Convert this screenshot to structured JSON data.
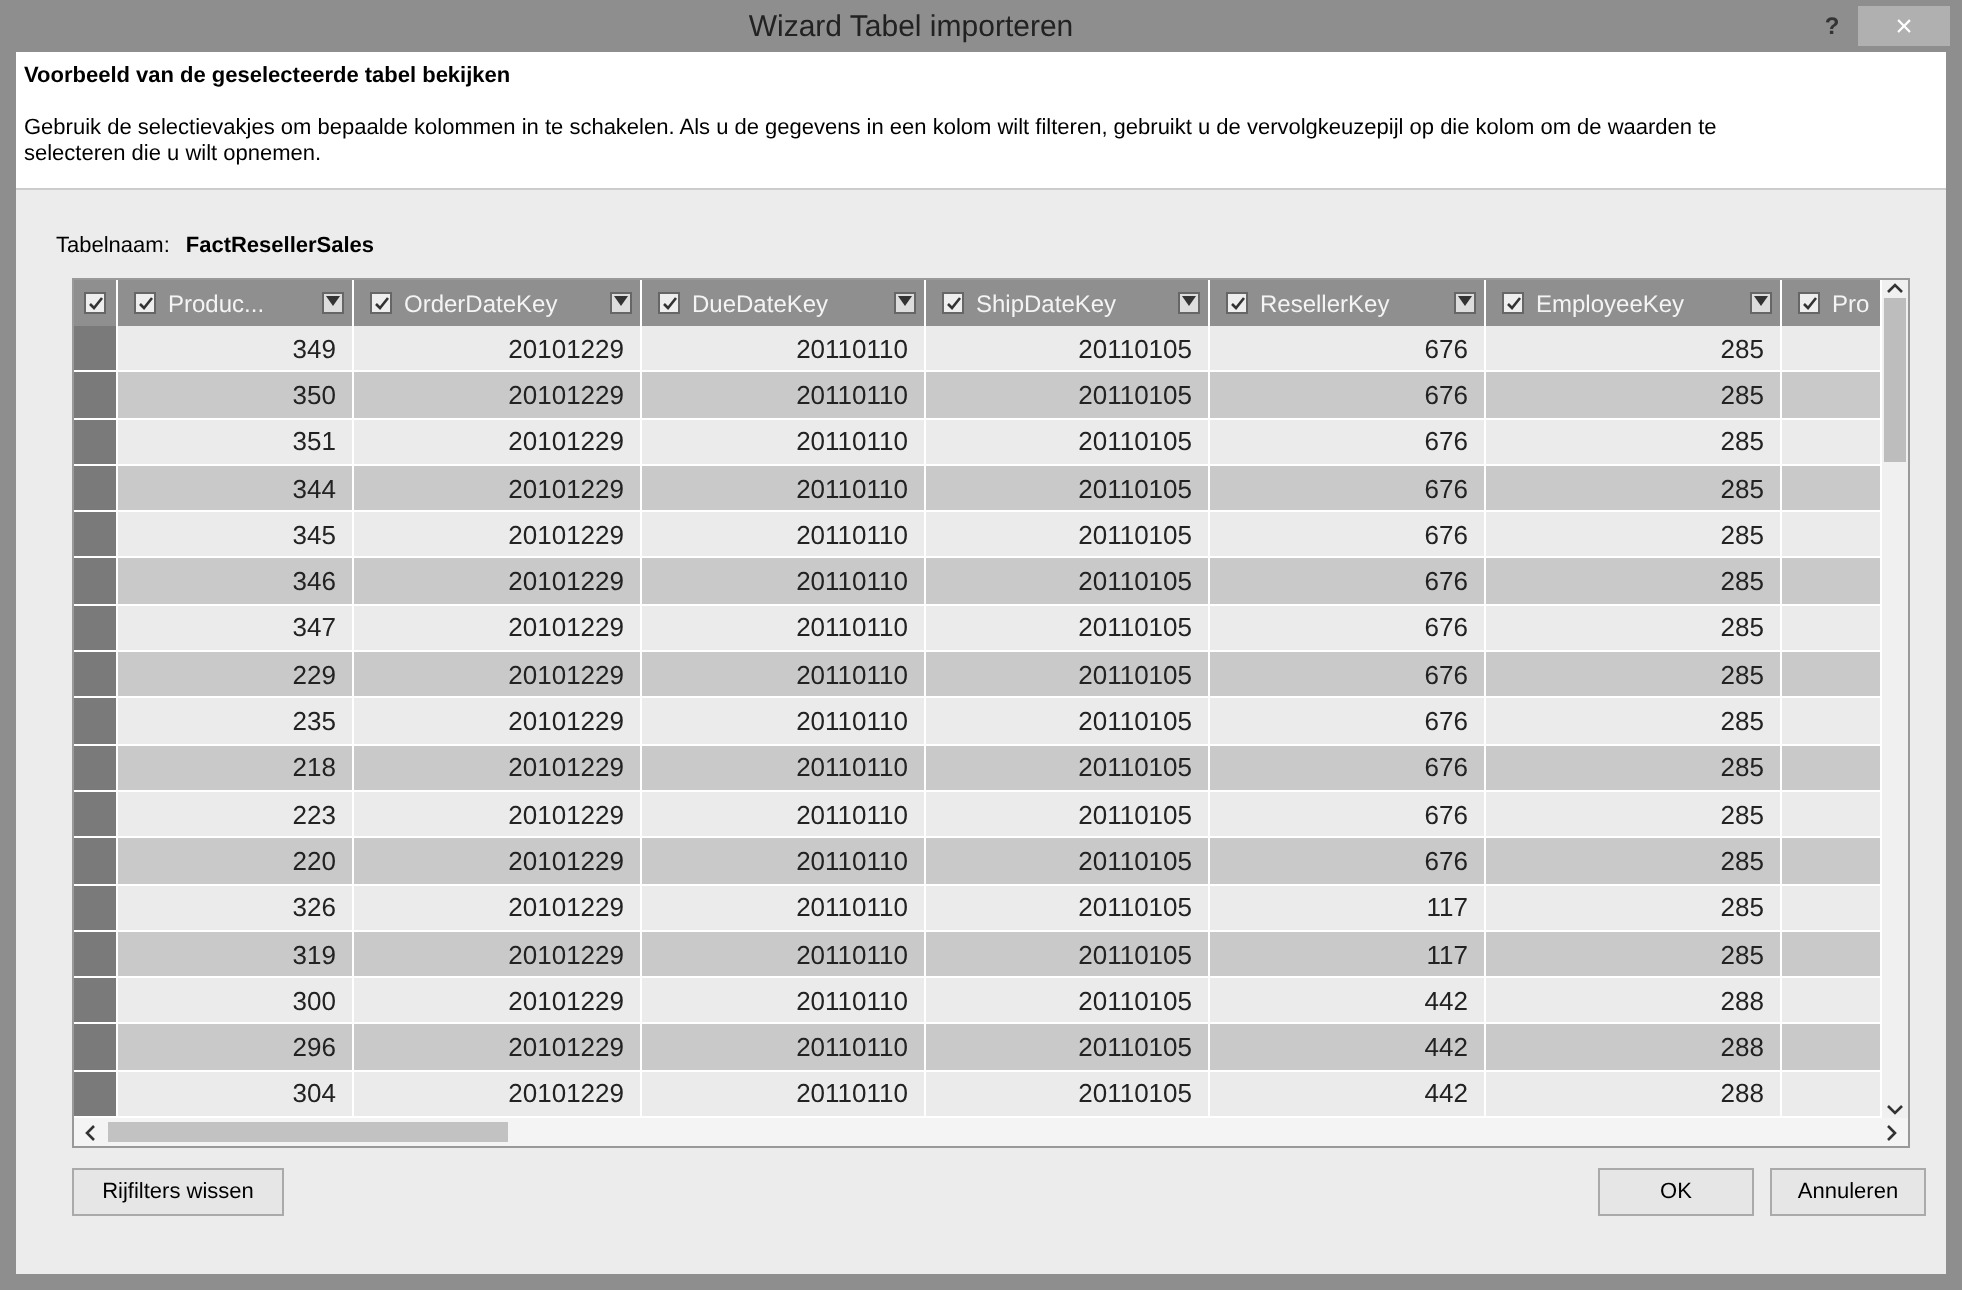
{
  "window": {
    "title": "Wizard Tabel importeren",
    "help": "?",
    "close": "×"
  },
  "heading": "Voorbeeld van de geselecteerde tabel bekijken",
  "description": "Gebruik de selectievakjes om bepaalde kolommen in te schakelen. Als u de gegevens in een kolom wilt filteren, gebruikt u de vervolgkeuzepijl op die kolom om de waarden te selecteren die u wilt opnemen.",
  "table_name": {
    "label": "Tabelnaam:",
    "value": "FactResellerSales"
  },
  "table": {
    "select_all": {
      "checked": true
    },
    "columns": [
      {
        "label": "Produc...",
        "checked": true
      },
      {
        "label": "OrderDateKey",
        "checked": true
      },
      {
        "label": "DueDateKey",
        "checked": true
      },
      {
        "label": "ShipDateKey",
        "checked": true
      },
      {
        "label": "ResellerKey",
        "checked": true
      },
      {
        "label": "EmployeeKey",
        "checked": true
      },
      {
        "label": "Pro",
        "checked": true
      }
    ],
    "rows": [
      [
        "349",
        "20101229",
        "20110110",
        "20110105",
        "676",
        "285"
      ],
      [
        "350",
        "20101229",
        "20110110",
        "20110105",
        "676",
        "285"
      ],
      [
        "351",
        "20101229",
        "20110110",
        "20110105",
        "676",
        "285"
      ],
      [
        "344",
        "20101229",
        "20110110",
        "20110105",
        "676",
        "285"
      ],
      [
        "345",
        "20101229",
        "20110110",
        "20110105",
        "676",
        "285"
      ],
      [
        "346",
        "20101229",
        "20110110",
        "20110105",
        "676",
        "285"
      ],
      [
        "347",
        "20101229",
        "20110110",
        "20110105",
        "676",
        "285"
      ],
      [
        "229",
        "20101229",
        "20110110",
        "20110105",
        "676",
        "285"
      ],
      [
        "235",
        "20101229",
        "20110110",
        "20110105",
        "676",
        "285"
      ],
      [
        "218",
        "20101229",
        "20110110",
        "20110105",
        "676",
        "285"
      ],
      [
        "223",
        "20101229",
        "20110110",
        "20110105",
        "676",
        "285"
      ],
      [
        "220",
        "20101229",
        "20110110",
        "20110105",
        "676",
        "285"
      ],
      [
        "326",
        "20101229",
        "20110110",
        "20110105",
        "117",
        "285"
      ],
      [
        "319",
        "20101229",
        "20110110",
        "20110105",
        "117",
        "285"
      ],
      [
        "300",
        "20101229",
        "20110110",
        "20110105",
        "442",
        "288"
      ],
      [
        "296",
        "20101229",
        "20110110",
        "20110105",
        "442",
        "288"
      ],
      [
        "304",
        "20101229",
        "20110110",
        "20110105",
        "442",
        "288"
      ]
    ]
  },
  "buttons": {
    "left": "Rijfilters wissen",
    "ok": "OK",
    "cancel": "Annuleren"
  }
}
